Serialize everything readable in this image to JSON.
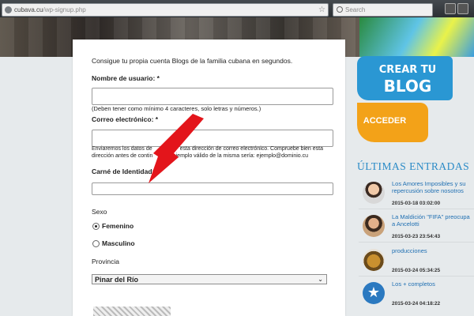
{
  "browser": {
    "url_host": "cubava.cu",
    "url_path": "/wp-signup.php",
    "search_placeholder": "Search"
  },
  "form": {
    "intro": "Consigue tu propia cuenta Blogs de la familia cubana en segundos.",
    "username_label": "Nombre de usuario: *",
    "username_value": "",
    "username_hint": "(Deben tener como mínimo 4 caracteres, solo letras y números.)",
    "email_label": "Correo electrónico: *",
    "email_value": "",
    "email_hint_line1": "Enviaremos los datos de                  esta dirección de correo electrónico. Compruebe bien esta",
    "email_hint_line2": "dirección antes de contin          n ejemplo válido de la misma sería: ejemplo@dominio.cu",
    "carne_label": "Carné de Identidad: *",
    "carne_value": "",
    "sexo_label": "Sexo",
    "sexo_options": [
      {
        "label": "Femenino",
        "selected": true
      },
      {
        "label": "Masculino",
        "selected": false
      }
    ],
    "provincia_label": "Provincia",
    "provincia_selected": "Pinar del Río"
  },
  "sidebar": {
    "crear_line1": "CREAR TU",
    "crear_line2": "BLOG",
    "acceder": "ACCEDER",
    "ultimas_title": "ÚLTIMAS ENTRADAS",
    "entries": [
      {
        "title_line1": "Los Amores Imposibles y su",
        "title_line2": "repercusión sobre nosotros",
        "date": "2015-03-18 03:02:00",
        "avatar": "person-avatar"
      },
      {
        "title_line1": "La Maldición \"FIFA\" preocupa",
        "title_line2": "a Ancelotti",
        "date": "2015-03-23 23:54:43",
        "avatar": "person-avatar"
      },
      {
        "title_line1": "producciones",
        "title_line2": "",
        "date": "2015-03-24 05:34:25",
        "avatar": "food-avatar"
      },
      {
        "title_line1": "Los + completos",
        "title_line2": "",
        "date": "2015-03-24 04:18:22",
        "avatar": "star-icon"
      }
    ]
  },
  "colors": {
    "crear_blue": "#2a97d3",
    "acceder_orange": "#f3a218",
    "link_blue": "#1f6fb2",
    "arrow_red": "#e3151b"
  }
}
